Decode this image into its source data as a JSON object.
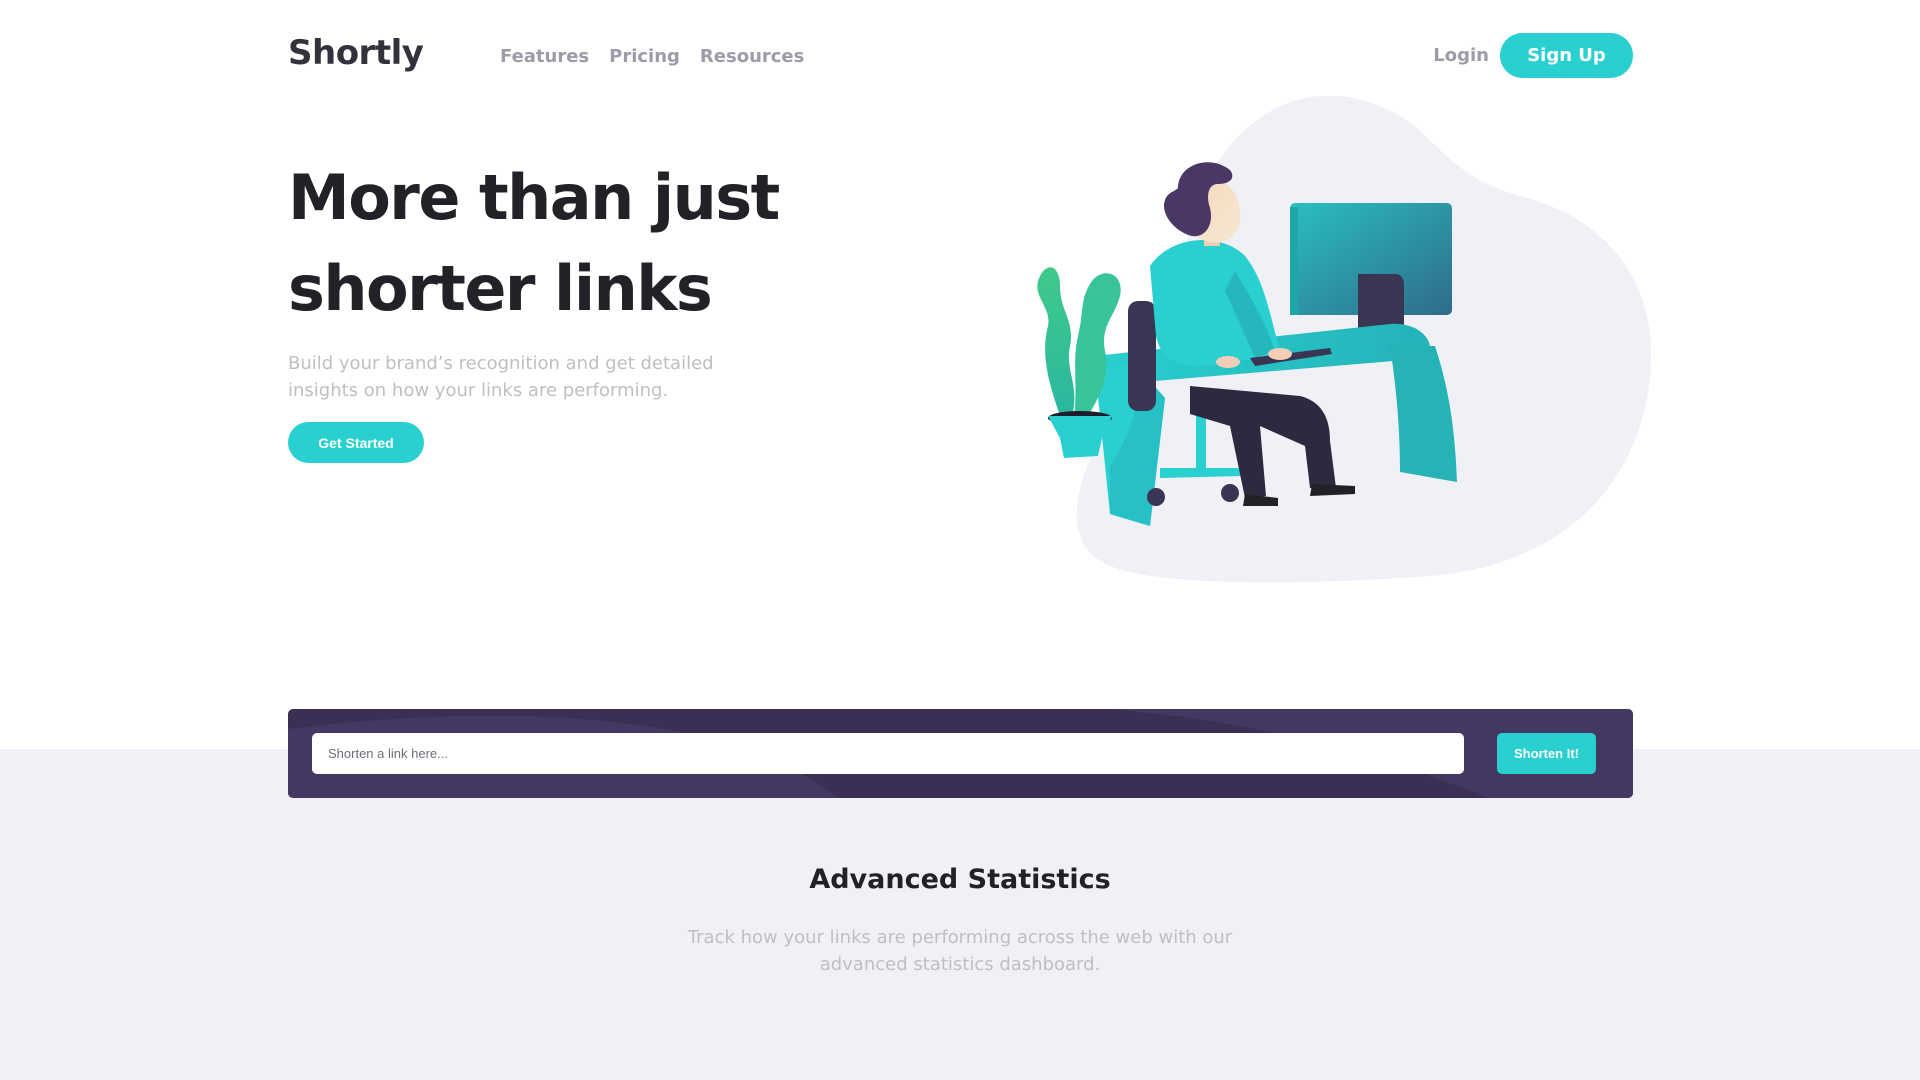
{
  "header": {
    "logo": "Shortly",
    "nav": [
      {
        "label": "Features"
      },
      {
        "label": "Pricing"
      },
      {
        "label": "Resources"
      }
    ],
    "login_label": "Login",
    "signup_label": "Sign Up"
  },
  "hero": {
    "title": "More than just shorter links",
    "subtitle": "Build your brand’s recognition and get detailed insights on how your links are performing.",
    "cta_label": "Get Started"
  },
  "shorten": {
    "placeholder": "Shorten a link here...",
    "value": "",
    "button_label": "Shorten It!"
  },
  "stats": {
    "title": "Advanced Statistics",
    "subtitle": "Track how your links are performing across the web with our advanced statistics dashboard."
  },
  "colors": {
    "accent": "#2acfcf",
    "dark_violet": "#3b3054",
    "gray_text": "#9e9aa8",
    "light_gray_bg": "#f0f1f6"
  }
}
